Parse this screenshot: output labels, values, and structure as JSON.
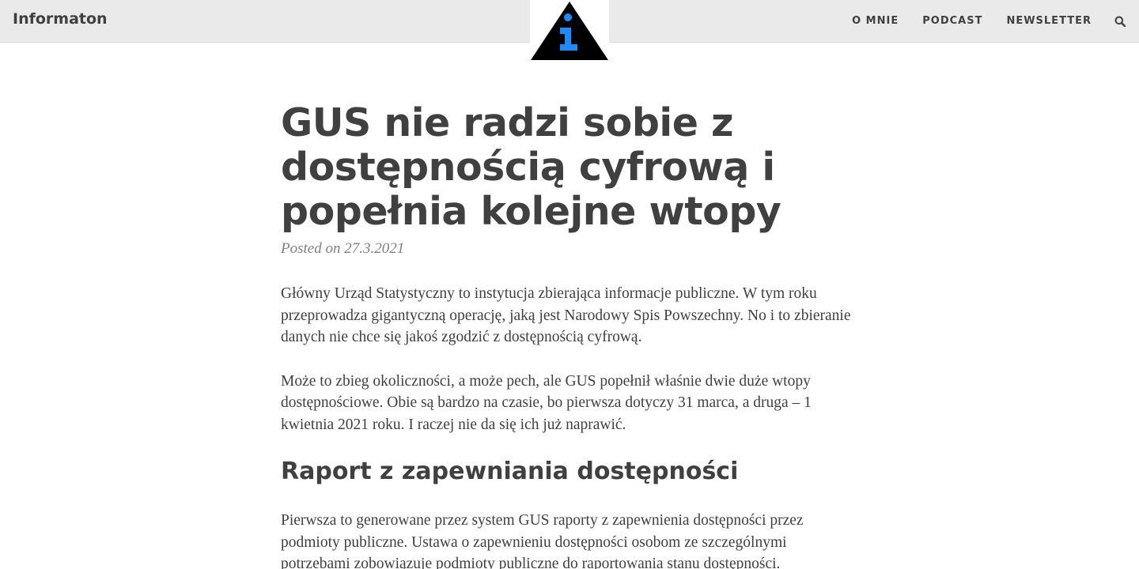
{
  "site": {
    "brand": "Informaton",
    "nav": [
      {
        "label": "O MNIE"
      },
      {
        "label": "PODCAST"
      },
      {
        "label": "NEWSLETTER"
      }
    ],
    "logo_glyph": "i",
    "colors": {
      "navbar_bg": "#eaeaea",
      "text": "#404040",
      "logo_triangle": "#000000",
      "logo_glyph": "#1a8cff",
      "meta": "#808080"
    },
    "icons": {
      "search": "search-icon",
      "logo": "info-triangle-logo"
    }
  },
  "post": {
    "title": "GUS nie radzi sobie z dostępnością cyfrową i popełnia kolejne wtopy",
    "meta": "Posted on 27.3.2021",
    "paragraphs": [
      "Główny Urząd Statystyczny to instytucja zbierająca informacje publiczne. W tym roku przeprowadza gigantyczną operację, jaką jest Narodowy Spis Powszechny. No i to zbieranie danych nie chce się jakoś zgodzić z dostępnością cyfrową.",
      "Może to zbieg okoliczności, a może pech, ale GUS popełnił właśnie dwie duże wtopy dostępnościowe. Obie są bardzo na czasie, bo pierwsza dotyczy 31 marca, a druga – 1 kwietnia 2021 roku. I raczej nie da się ich już naprawić."
    ],
    "section_heading": "Raport z zapewniania dostępności",
    "section_paragraph": "Pierwsza to generowane przez system GUS raporty z zapewnienia dostępności przez podmioty publiczne. Ustawa o zapewnieniu dostępności osobom ze szczególnymi potrzebami zobowiązuje podmioty publiczne do raportowania stanu dostępności."
  }
}
